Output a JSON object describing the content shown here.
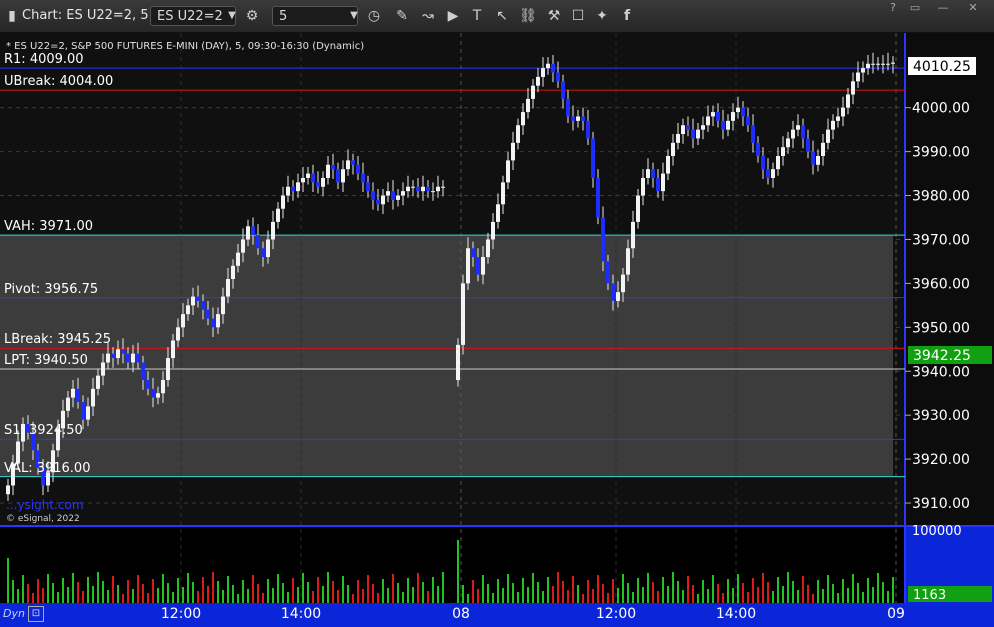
{
  "window": {
    "title": "Chart: ES U22=2, 5",
    "symbol_value": "ES U22=2",
    "interval_value": "5"
  },
  "header": {
    "description": "* ES U22=2, S&P 500 FUTURES E-MINI (DAY), 5, 09:30-16:30 (Dynamic)",
    "watermark": "...ysight.com",
    "copyright": "© eSignal, 2022"
  },
  "bottombar": {
    "mode": "Dyn",
    "x_ticks": [
      {
        "label": "12:00",
        "bar": 35
      },
      {
        "label": "14:00",
        "bar": 59
      },
      {
        "label": "08",
        "bar": 91
      },
      {
        "label": "12:00",
        "bar": 122
      },
      {
        "label": "14:00",
        "bar": 146
      },
      {
        "label": "09",
        "bar": 178
      }
    ]
  },
  "levels": [
    {
      "label": "R1: 4009.00",
      "value": 4009.0,
      "color": "#2a35ff"
    },
    {
      "label": "UBreak: 4004.00",
      "value": 4004.0,
      "color": "#e01010"
    },
    {
      "label": "VAH: 3971.00",
      "value": 3971.0,
      "color": "#30d8d8"
    },
    {
      "label": "Pivot: 3956.75",
      "value": 3956.75,
      "color": "#2a35ff"
    },
    {
      "label": "LBreak: 3945.25",
      "value": 3945.25,
      "color": "#e01010"
    },
    {
      "label": "LPT: 3940.50",
      "value": 3940.5,
      "color": "#c8c8c8"
    },
    {
      "label": "S1: 3924.50",
      "value": 3924.5,
      "color": "#2a35ff"
    },
    {
      "label": "VAL: 3916.00",
      "value": 3916.0,
      "color": "#30d8d8"
    }
  ],
  "badges": {
    "last_price": "4010.25",
    "ref_price": "3942.25",
    "volume": "1163",
    "vol_axis": "100000"
  },
  "chart_data": {
    "type": "candlestick",
    "title": "",
    "y_ticks": [
      3910,
      3920,
      3930,
      3940,
      3950,
      3960,
      3970,
      3980,
      3990,
      4000
    ],
    "ylim": [
      3905,
      4017
    ],
    "volume_ylim": [
      0,
      100000
    ],
    "bars_per_session": 88,
    "grid": true,
    "value_area": [
      3916.0,
      3971.0
    ],
    "session1_close": [
      3914.0,
      3919.0,
      3924.0,
      3928.0,
      3926.0,
      3922.0,
      3918.0,
      3914.0,
      3917.0,
      3922.0,
      3927.0,
      3931.0,
      3934.0,
      3936.0,
      3933.0,
      3929.0,
      3932.0,
      3936.0,
      3939.0,
      3942.0,
      3944.0,
      3943.0,
      3945.0,
      3944.0,
      3942.0,
      3944.0,
      3942.0,
      3938.0,
      3936.0,
      3934.0,
      3935.0,
      3938.0,
      3943.0,
      3947.0,
      3950.0,
      3953.0,
      3955.0,
      3957.0,
      3956.0,
      3954.0,
      3952.0,
      3950.0,
      3953.0,
      3957.0,
      3961.0,
      3964.0,
      3967.0,
      3970.0,
      3973.0,
      3971.0,
      3968.0,
      3966.0,
      3970.0,
      3974.0,
      3977.0,
      3980.0,
      3982.0,
      3981.0,
      3983.0,
      3984.0,
      3985.0,
      3983.0,
      3982.0,
      3984.0,
      3987.0,
      3986.0,
      3983.0,
      3986.0,
      3988.0,
      3987.0,
      3985.0,
      3983.0,
      3981.0,
      3979.0,
      3978.0,
      3980.0,
      3981.0,
      3979.0,
      3980.0,
      3981.0,
      3982.0,
      3982.0,
      3981.0,
      3982.0,
      3981.0,
      3981.0,
      3982.0,
      3982.0
    ],
    "session2_close": [
      3946.0,
      3960.0,
      3968.0,
      3966.0,
      3962.0,
      3966.0,
      3970.0,
      3974.0,
      3978.0,
      3983.0,
      3988.0,
      3992.0,
      3996.0,
      3999.0,
      4002.0,
      4005.0,
      4007.0,
      4009.0,
      4010.0,
      4008.0,
      4006.0,
      4002.0,
      3998.0,
      3997.0,
      3998.0,
      3997.0,
      3993.0,
      3984.0,
      3975.0,
      3965.0,
      3960.0,
      3956.0,
      3958.0,
      3962.0,
      3968.0,
      3974.0,
      3980.0,
      3984.0,
      3986.0,
      3984.0,
      3981.0,
      3985.0,
      3989.0,
      3992.0,
      3994.0,
      3996.0,
      3995.0,
      3993.0,
      3995.0,
      3996.0,
      3998.0,
      3999.0,
      3997.0,
      3995.0,
      3997.0,
      3999.0,
      4000.0,
      3998.0,
      3996.0,
      3992.0,
      3989.0,
      3986.0,
      3984.0,
      3986.0,
      3989.0,
      3991.0,
      3993.0,
      3995.0,
      3996.0,
      3993.0,
      3990.0,
      3987.0,
      3989.0,
      3992.0,
      3995.0,
      3997.0,
      3998.0,
      4000.0,
      4003.0,
      4006.0,
      4008.0,
      4009.0,
      4010.0,
      4010.0,
      4010.0,
      4010.0,
      4010.0,
      4010.25
    ]
  }
}
